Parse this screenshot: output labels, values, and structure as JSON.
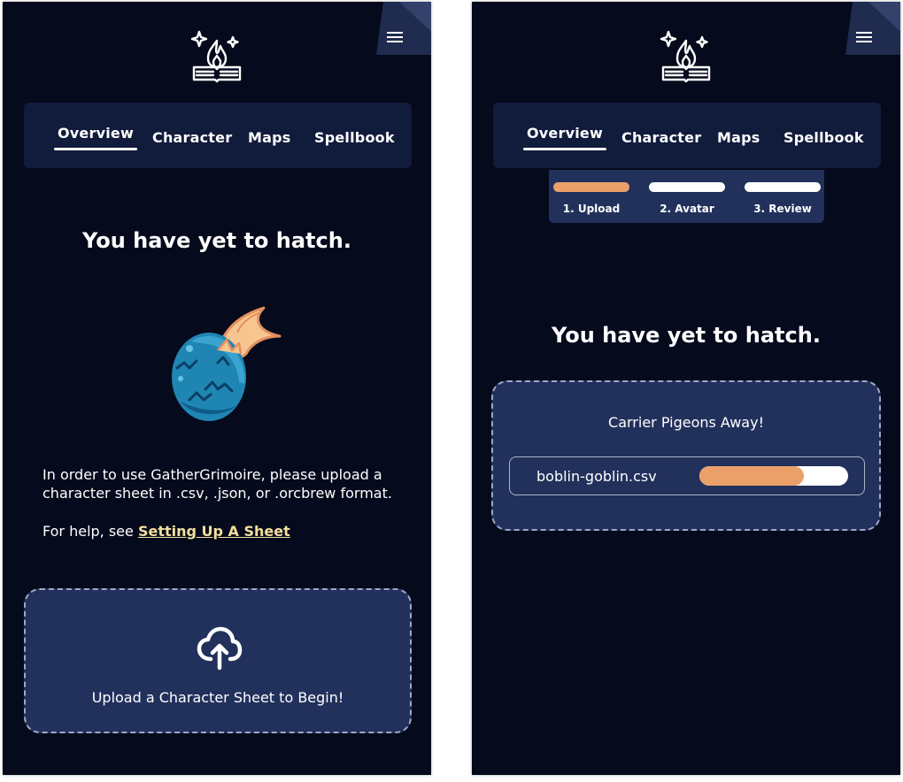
{
  "colors": {
    "background": "#050a1c",
    "nav": "#111c3c",
    "panel": "#22315c",
    "accent": "#eba06a",
    "link": "#f3df9c"
  },
  "nav": {
    "tabs": [
      {
        "label": "Overview",
        "active": true
      },
      {
        "label": "Character",
        "active": false
      },
      {
        "label": "Maps",
        "active": false
      },
      {
        "label": "Spellbook",
        "active": false
      }
    ]
  },
  "icons": {
    "logo": "sparkle-flame-book-icon",
    "menu": "hamburger-menu-icon",
    "egg": "dragon-egg-illustration",
    "upload": "cloud-upload-icon"
  },
  "left_screen": {
    "title": "You have yet to hatch.",
    "instructions_line1": "In order to use GatherGrimoire, please upload a",
    "instructions_line2": "character sheet in .csv, .json, or .orcbrew format.",
    "help_prefix": "For help, see ",
    "help_link": "Setting Up A Sheet",
    "upload_label": "Upload a Character Sheet to Begin!"
  },
  "right_screen": {
    "steps": [
      {
        "label": "1. Upload",
        "state": "active"
      },
      {
        "label": "2. Avatar",
        "state": "pending"
      },
      {
        "label": "3. Review",
        "state": "pending"
      }
    ],
    "title": "You have yet to hatch.",
    "status_title": "Carrier Pigeons Away!",
    "file_name": "boblin-goblin.csv",
    "upload_progress": 0.7
  }
}
